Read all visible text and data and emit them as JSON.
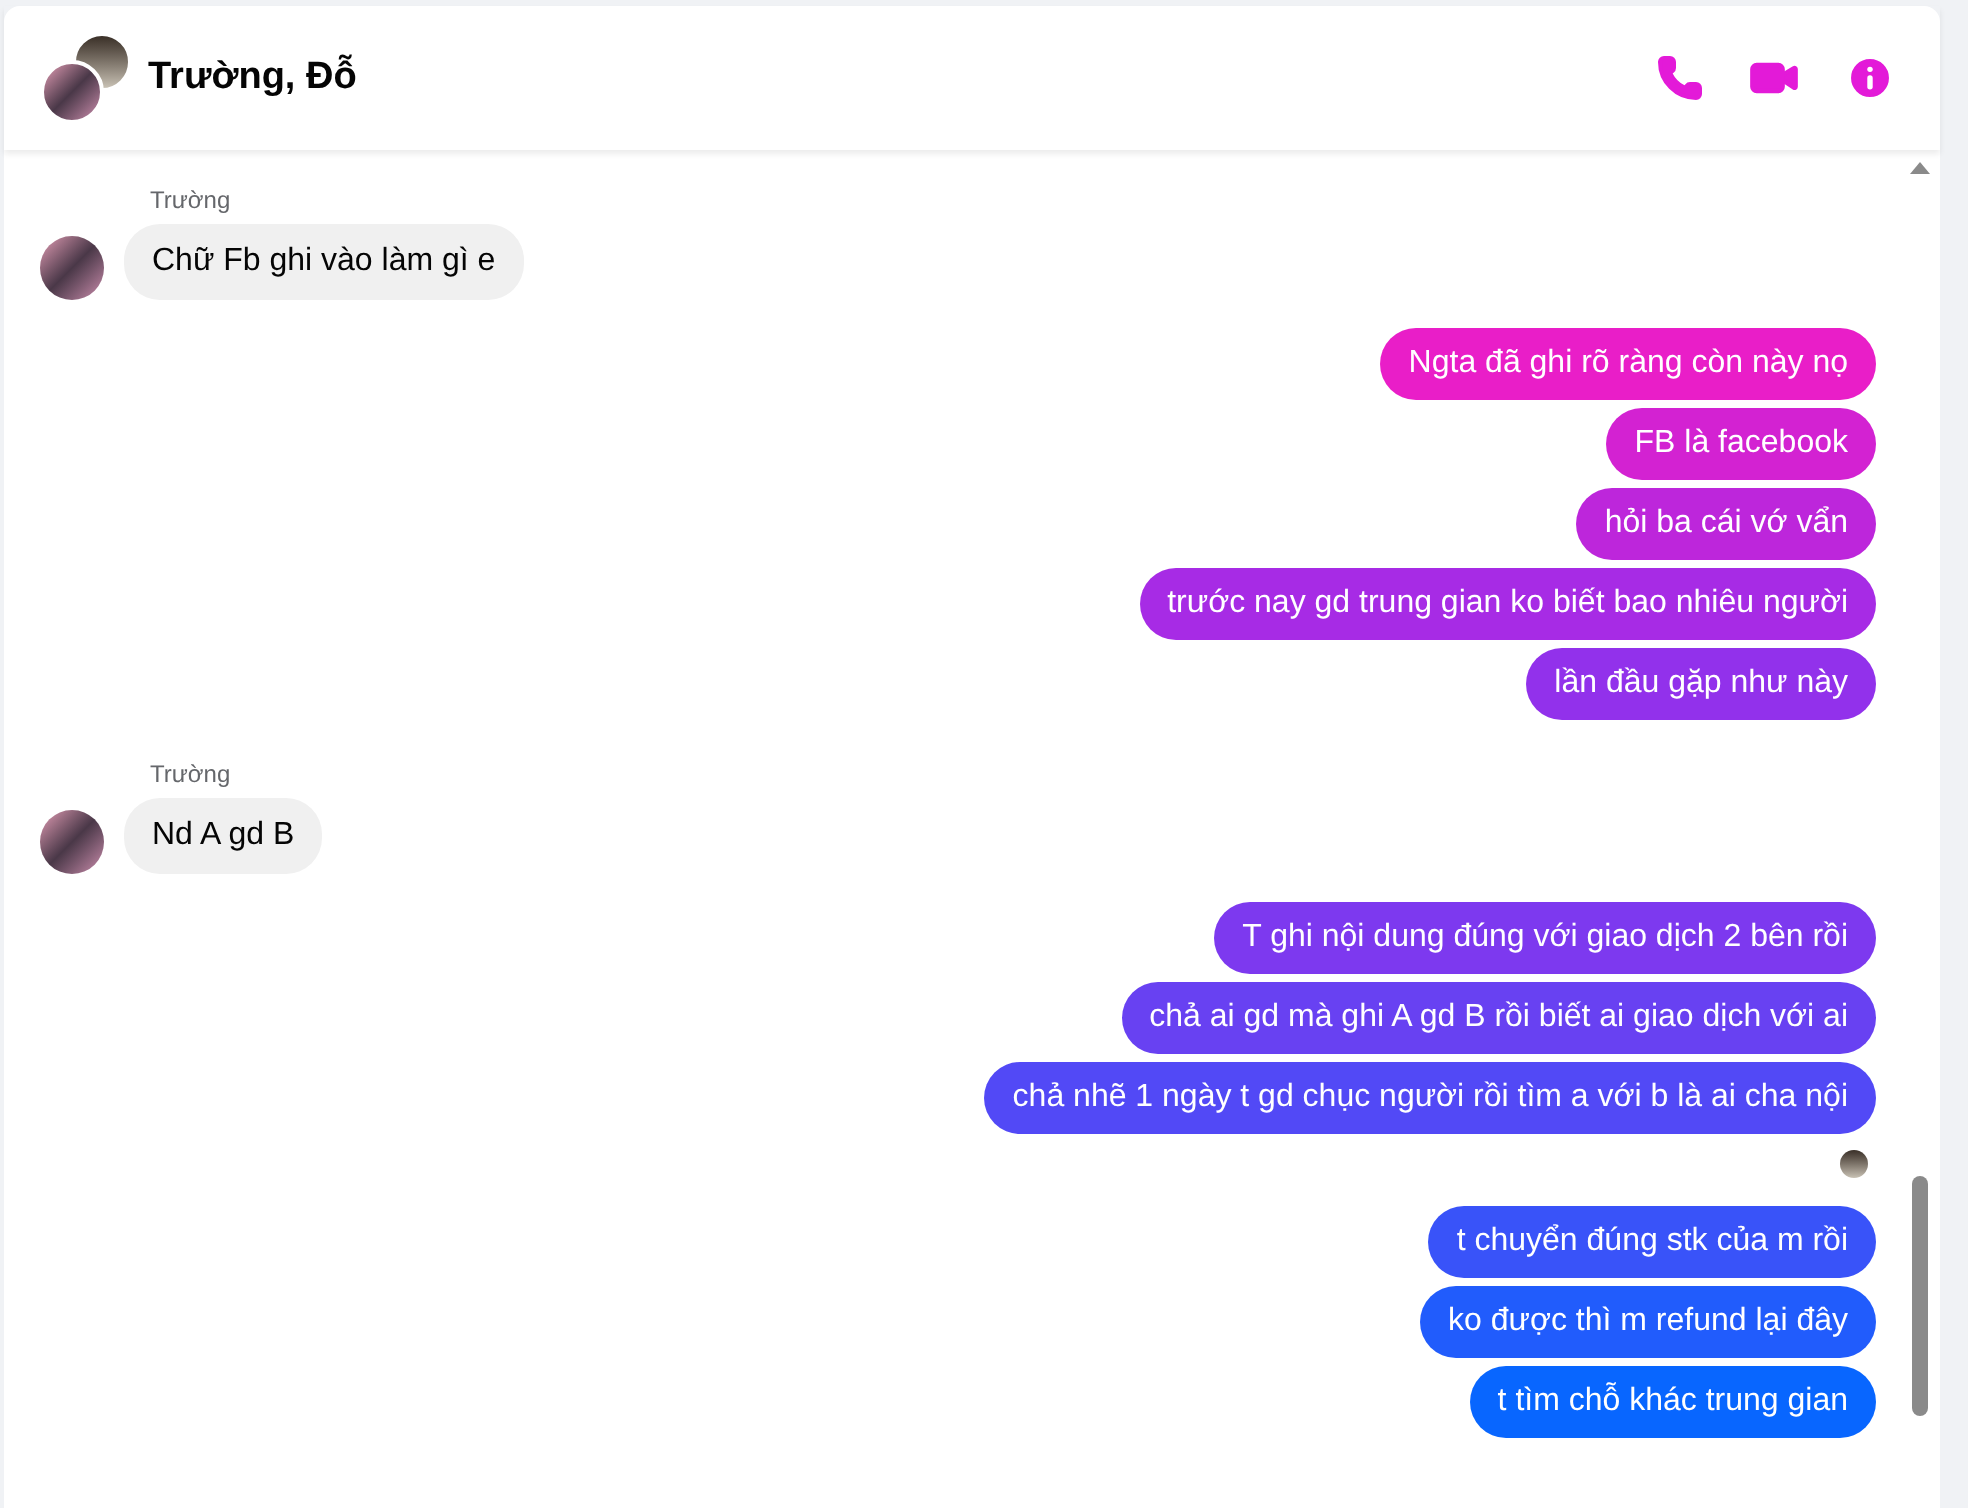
{
  "header": {
    "title": "Trường, Đỗ"
  },
  "groups": [
    {
      "kind": "incoming",
      "sender": "Trường",
      "texts": [
        "Chữ Fb ghi vào làm gì e"
      ]
    },
    {
      "kind": "outgoing",
      "seen": false,
      "texts": [
        "Ngta đã ghi rõ ràng còn này nọ",
        "FB là facebook",
        "hỏi ba cái vớ vẩn",
        "trước nay gd trung gian ko biết bao nhiêu người",
        "lần đầu gặp như này"
      ]
    },
    {
      "kind": "incoming",
      "sender": "Trường",
      "texts": [
        "Nd A gd B"
      ]
    },
    {
      "kind": "outgoing",
      "seen": true,
      "texts": [
        "T ghi nội dung đúng với giao dịch 2 bên rồi",
        "chả ai gd mà ghi A gd B rồi biết ai giao dịch với ai",
        "chả nhẽ 1 ngày t gd chục người rồi tìm a với b là ai cha nội"
      ]
    },
    {
      "kind": "outgoing",
      "seen": false,
      "texts": [
        "t chuyển đúng stk của m rồi",
        "ko được thì m refund lại đây",
        "t tìm chỗ khác trung gian"
      ]
    }
  ]
}
